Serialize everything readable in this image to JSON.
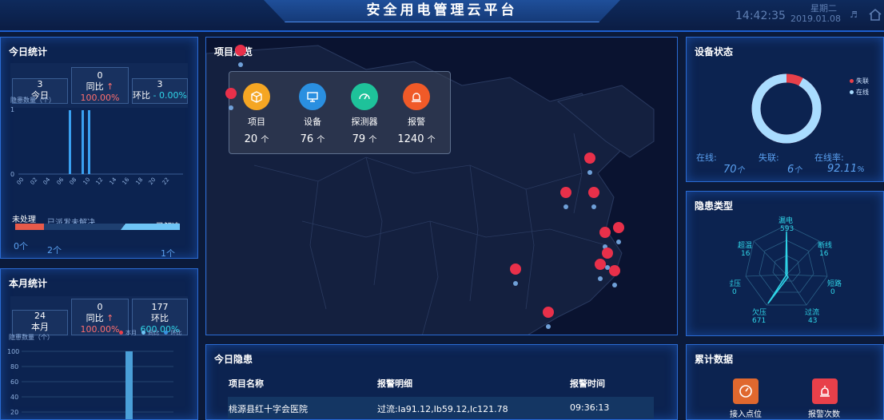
{
  "header": {
    "title": "安全用电管理云平台",
    "time": "14:42:35",
    "weekday": "星期二",
    "date": "2019.01.08"
  },
  "today": {
    "title": "今日统计",
    "today_value": "3",
    "today_label": "今日",
    "yoy_value": "0",
    "yoy_label": "同比",
    "yoy_arrow": "↑",
    "yoy_pct": "100.00%",
    "mom_value": "3",
    "mom_label": "环比",
    "mom_pct": "- 0.00%",
    "axis_label": "隐患数量（个）",
    "y_ticks": [
      "1",
      "0"
    ],
    "x_ticks": [
      "00",
      "02",
      "04",
      "06",
      "08",
      "10",
      "12",
      "14",
      "16",
      "18",
      "20",
      "22"
    ],
    "status": {
      "unhandled_label": "未处理",
      "dispatched_label": "已派发未解决",
      "resolved_label": "已解决",
      "unhandled_count": "0个",
      "dispatched_count": "2个",
      "resolved_count": "1个"
    }
  },
  "month": {
    "title": "本月统计",
    "month_value": "24",
    "month_label": "本月",
    "yoy_value": "0",
    "yoy_label": "同比",
    "yoy_arrow": "↑",
    "yoy_pct": "100.00%",
    "mom_value": "177",
    "mom_label": "环比",
    "mom_pct": "600.00%",
    "axis_label": "隐患数量（个）",
    "legend": [
      "本月",
      "同比",
      "环比"
    ],
    "y_ticks": [
      "100",
      "80",
      "60",
      "40",
      "20"
    ]
  },
  "overview": {
    "title": "项目总览",
    "items": [
      {
        "label": "项目",
        "count": "20",
        "unit": "个",
        "icon": "box-icon",
        "color": "#f5a623"
      },
      {
        "label": "设备",
        "count": "76",
        "unit": "个",
        "icon": "monitor-icon",
        "color": "#2a8fe0"
      },
      {
        "label": "探测器",
        "count": "79",
        "unit": "个",
        "icon": "gauge-icon",
        "color": "#1ec29a"
      },
      {
        "label": "报警",
        "count": "1240",
        "unit": "个",
        "icon": "alarm-icon",
        "color": "#f05a28"
      }
    ]
  },
  "device_status": {
    "title": "设备状态",
    "legend_lost": "失联",
    "legend_online": "在线",
    "online_label": "在线:",
    "lost_label": "失联:",
    "rate_label": "在线率:",
    "online_value": "70",
    "online_unit": "个",
    "lost_value": "6",
    "lost_unit": "个",
    "rate_value": "92.11",
    "rate_unit": "%",
    "online_fraction": 0.9211,
    "color_online": "#a9dcff",
    "color_lost": "#e8404a"
  },
  "hazard_types": {
    "title": "隐患类型",
    "labels": [
      {
        "name": "漏电",
        "value": "593"
      },
      {
        "name": "断线",
        "value": "16"
      },
      {
        "name": "短路",
        "value": "0"
      },
      {
        "name": "过流",
        "value": "43"
      },
      {
        "name": "欠压",
        "value": "671"
      },
      {
        "name": "过压",
        "value": "0"
      },
      {
        "name": "超温",
        "value": "16"
      }
    ]
  },
  "today_hazards": {
    "title": "今日隐患",
    "col_name": "项目名称",
    "col_detail": "报警明细",
    "col_time": "报警时间",
    "rows": [
      {
        "name": "桃源县红十字会医院",
        "detail": "过流:Ia91.12,Ib59.12,Ic121.78",
        "time": "09:36:13"
      }
    ]
  },
  "totals": {
    "title": "累计数据",
    "access_label": "接入点位",
    "alarm_label": "报警次数"
  }
}
